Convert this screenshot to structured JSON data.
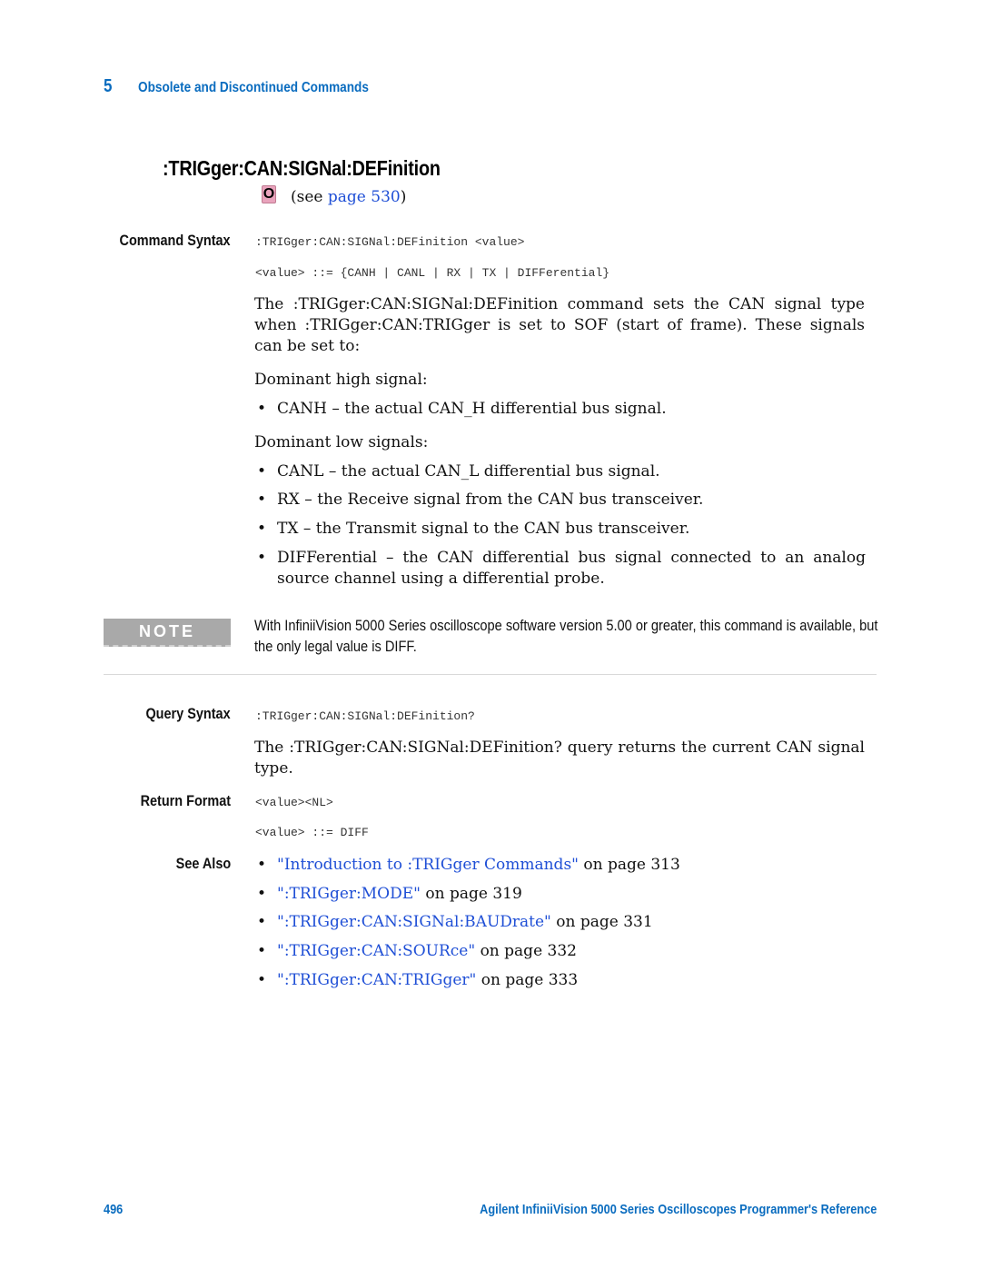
{
  "header": {
    "chapter_number": "5",
    "chapter_title": "Obsolete and Discontinued Commands"
  },
  "title": ":TRIGger:CAN:SIGNal:DEFinition",
  "obsolete_ref": {
    "icon": "obsolete-icon",
    "icon_glyph": "O",
    "prefix": "(see ",
    "link_text": "page 530",
    "suffix": ")"
  },
  "command_syntax": {
    "label": "Command Syntax",
    "syntax": ":TRIGger:CAN:SIGNal:DEFinition <value>",
    "value_def": "<value> ::= {CANH | CANL | RX | TX | DIFFerential}",
    "description": "The :TRIGger:CAN:SIGNal:DEFinition command sets the CAN signal type when :TRIGger:CAN:TRIGger is set to SOF (start of frame). These signals can be set to:",
    "high_heading": "Dominant high signal:",
    "high_items": [
      "CANH – the actual CAN_H differential bus signal."
    ],
    "low_heading": "Dominant low signals:",
    "low_items": [
      "CANL – the actual CAN_L differential bus signal.",
      "RX – the Receive signal from the CAN bus transceiver.",
      "TX – the Transmit signal to the CAN bus transceiver.",
      "DIFFerential – the CAN differential bus signal connected to an analog source channel using a differential probe."
    ]
  },
  "note": {
    "badge": "NOTE",
    "text": "With InfiniiVision 5000 Series oscilloscope software version 5.00 or greater, this command is available, but the only legal value is DIFF."
  },
  "query_syntax": {
    "label": "Query Syntax",
    "syntax": ":TRIGger:CAN:SIGNal:DEFinition?",
    "description": "The :TRIGger:CAN:SIGNal:DEFinition? query returns the current CAN signal type."
  },
  "return_format": {
    "label": "Return Format",
    "format": "<value><NL>",
    "value_def": "<value> ::= DIFF"
  },
  "see_also": {
    "label": "See Also",
    "items": [
      {
        "link": "\"Introduction to :TRIGger Commands\"",
        "suffix": " on page 313"
      },
      {
        "link": "\":TRIGger:MODE\"",
        "suffix": " on page 319"
      },
      {
        "link": "\":TRIGger:CAN:SIGNal:BAUDrate\"",
        "suffix": " on page 331"
      },
      {
        "link": "\":TRIGger:CAN:SOURce\"",
        "suffix": " on page 332"
      },
      {
        "link": "\":TRIGger:CAN:TRIGger\"",
        "suffix": " on page 333"
      }
    ]
  },
  "footer": {
    "page_number": "496",
    "book_title": "Agilent InfiniiVision 5000 Series Oscilloscopes Programmer's Reference"
  },
  "colors": {
    "accent_blue": "#0a6cbf",
    "link_blue": "#1f4fd6",
    "note_gray": "#a9a9a9",
    "obsolete_pink": "#e9a3bc"
  }
}
